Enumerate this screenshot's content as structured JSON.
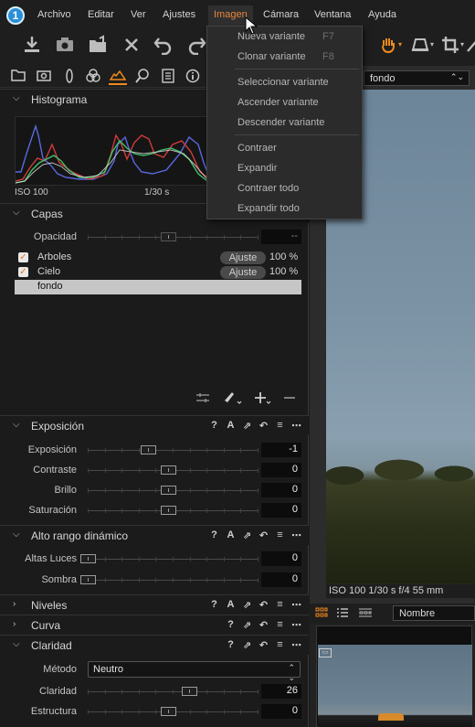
{
  "app": {
    "logo_text": "1"
  },
  "menubar": {
    "items": [
      {
        "label": "Archivo"
      },
      {
        "label": "Editar"
      },
      {
        "label": "Ver"
      },
      {
        "label": "Ajustes"
      },
      {
        "label": "Imagen",
        "active": true
      },
      {
        "label": "Cámara"
      },
      {
        "label": "Ventana"
      },
      {
        "label": "Ayuda"
      }
    ]
  },
  "image_menu": {
    "items": [
      {
        "label": "Nueva variante",
        "shortcut": "F7"
      },
      {
        "label": "Clonar variante",
        "shortcut": "F8"
      },
      {
        "label": "Seleccionar variante"
      },
      {
        "label": "Ascender variante"
      },
      {
        "label": "Descender variante"
      },
      {
        "label": "Contraer"
      },
      {
        "label": "Expandir"
      },
      {
        "label": "Contraer todo"
      },
      {
        "label": "Expandir todo"
      }
    ]
  },
  "toolbar": {
    "icons": [
      "import-icon",
      "camera-icon",
      "folder-export-icon",
      "close-icon",
      "undo-icon",
      "redo-icon",
      "hand-icon",
      "keystone-icon",
      "crop-icon",
      "rotate-icon"
    ]
  },
  "tool_tabs": [
    "library-icon",
    "capture-icon",
    "color-icon",
    "exposure-icon",
    "details-icon",
    "metadata-icon",
    "info-icon"
  ],
  "histogram": {
    "title": "Histograma",
    "iso": "ISO 100",
    "shutter": "1/30 s"
  },
  "layers": {
    "title": "Capas",
    "opacity_label": "Opacidad",
    "opacity_value": "--",
    "items": [
      {
        "name": "Arboles",
        "checked": true,
        "badge": "Ajuste",
        "percent": "100 %"
      },
      {
        "name": "Cielo",
        "checked": true,
        "badge": "Ajuste",
        "percent": "100 %"
      },
      {
        "name": "fondo",
        "selected": true
      }
    ]
  },
  "exposure": {
    "title": "Exposición",
    "tools": [
      "?",
      "A"
    ],
    "rows": [
      {
        "label": "Exposición",
        "value": "-1",
        "level": 0.33
      },
      {
        "label": "Contraste",
        "value": "0",
        "level": 0.5
      },
      {
        "label": "Brillo",
        "value": "0",
        "level": 0.5
      },
      {
        "label": "Saturación",
        "value": "0",
        "level": 0.5
      }
    ]
  },
  "hdr": {
    "title": "Alto rango dinámico",
    "tools": [
      "?",
      "A"
    ],
    "rows": [
      {
        "label": "Altas Luces",
        "value": "0",
        "level": 0
      },
      {
        "label": "Sombra",
        "value": "0",
        "level": 0
      }
    ]
  },
  "levels": {
    "title": "Niveles",
    "tools": [
      "?",
      "A"
    ]
  },
  "curve": {
    "title": "Curva",
    "tools": [
      "?"
    ]
  },
  "clarity": {
    "title": "Claridad",
    "tools": [
      "?"
    ],
    "method_label": "Método",
    "method_value": "Neutro",
    "rows": [
      {
        "label": "Claridad",
        "value": "26",
        "level": 0.63
      },
      {
        "label": "Estructura",
        "value": "0",
        "level": 0.5
      }
    ]
  },
  "viewer": {
    "preset": "fondo",
    "info": "ISO 100  1/30 s  f/4  55 mm"
  },
  "browser": {
    "sort": "Nombre"
  },
  "colors": {
    "accent": "#f08a1c",
    "menu_active": "#e8863a"
  }
}
